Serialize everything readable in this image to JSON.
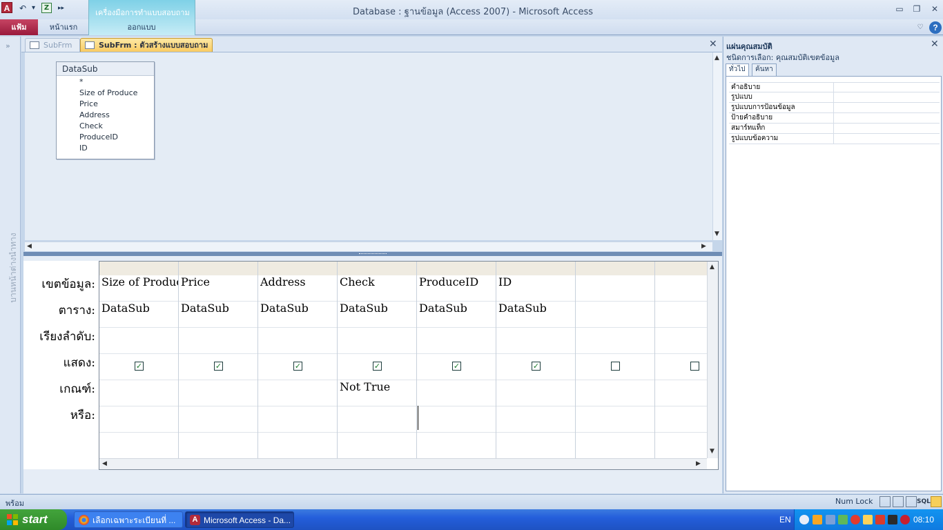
{
  "window": {
    "title": "Database : ฐานข้อมูล (Access 2007)  -  Microsoft Access",
    "app_icon_letter": "A",
    "minimize": "▭",
    "restore": "❐",
    "close": "✕"
  },
  "quick_access": {
    "undo": "↶",
    "dropdown": "▾",
    "excel": "Z",
    "more": "▸▸"
  },
  "ribbon": {
    "context_group": "เครื่องมือการทำแบบสอบถาม",
    "tabs": [
      "แฟ้ม",
      "หน้าแรก",
      "ออกแบบ"
    ],
    "minimize_glyph": "♡",
    "help": "?"
  },
  "nav_pane": {
    "chevron": "»",
    "label": "บานหน้าต่างนำทาง"
  },
  "doc_tabs": {
    "tabs": [
      "SubFrm",
      "SubFrm : ตัวสร้างแบบสอบถาม"
    ],
    "close": "✕"
  },
  "table_box": {
    "title": "DataSub",
    "fields": [
      "*",
      "Size of Produce",
      "Price",
      "Address",
      "Check",
      "ProduceID",
      "ID"
    ]
  },
  "grid": {
    "row_labels": [
      "เขตข้อมูล:",
      "ตาราง:",
      "เรียงลำดับ:",
      "แสดง:",
      "เกณฑ์:",
      "หรือ:"
    ],
    "columns": [
      {
        "field": "Size of Produce",
        "table": "DataSub",
        "show": true,
        "criteria": ""
      },
      {
        "field": "Price",
        "table": "DataSub",
        "show": true,
        "criteria": ""
      },
      {
        "field": "Address",
        "table": "DataSub",
        "show": true,
        "criteria": ""
      },
      {
        "field": "Check",
        "table": "DataSub",
        "show": true,
        "criteria": "Not True"
      },
      {
        "field": "ProduceID",
        "table": "DataSub",
        "show": true,
        "criteria": ""
      },
      {
        "field": "ID",
        "table": "DataSub",
        "show": true,
        "criteria": ""
      },
      {
        "field": "",
        "table": "",
        "show": false,
        "criteria": ""
      },
      {
        "field": "",
        "table": "",
        "show": false,
        "criteria": ""
      }
    ]
  },
  "property_sheet": {
    "title": "แผ่นคุณสมบัติ",
    "selection_label": "ชนิดการเลือก:  คุณสมบัติเขตข้อมูล",
    "tabs": [
      "ทั่วไป",
      "ค้นหา"
    ],
    "properties": [
      "คำอธิบาย",
      "รูปแบบ",
      "รูปแบบการป้อนข้อมูล",
      "ป้ายคำอธิบาย",
      "สมาร์ทแท็ก",
      "รูปแบบข้อความ"
    ],
    "close": "✕"
  },
  "status_bar": {
    "text": "พร้อม",
    "numlock": "Num Lock",
    "sql": "SQL"
  },
  "taskbar": {
    "start": "start",
    "tasks": [
      "เลือกเฉพาะระเบียนที่ ...",
      "Microsoft Access - Da..."
    ],
    "lang": "EN",
    "clock": "08:10"
  },
  "colors": {
    "ribbon_file_tab": "#9a1a3c",
    "context_group": "#7fd1e7",
    "active_doc_tab": "#f9cb62",
    "checkbox_check": "#1a7a2a",
    "taskbar": "#245edb",
    "start_button": "#2f8a29"
  }
}
